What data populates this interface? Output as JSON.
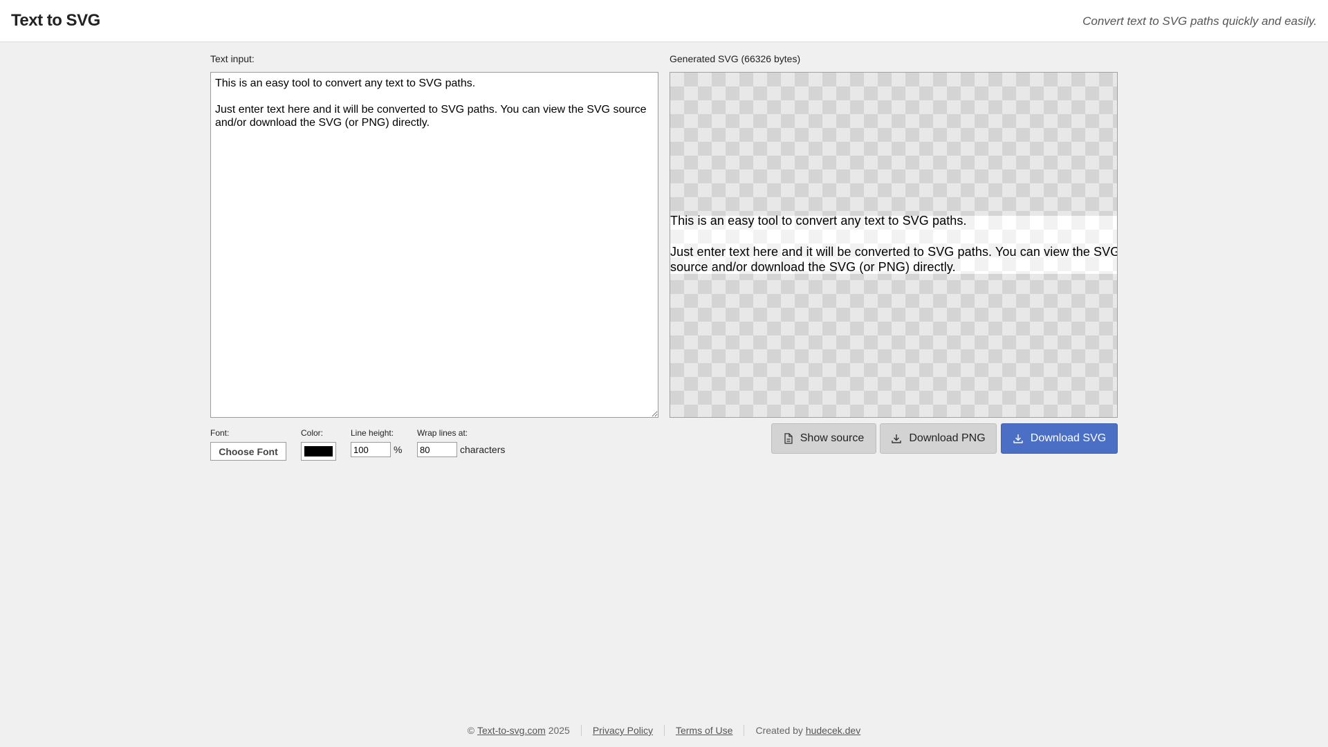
{
  "header": {
    "title": "Text to SVG",
    "tagline": "Convert text to SVG paths quickly and easily."
  },
  "input_panel": {
    "label": "Text input:",
    "text": "This is an easy tool to convert any text to SVG paths.\n\nJust enter text here and it will be converted to SVG paths. You can view the SVG source and/or download the SVG (or PNG) directly."
  },
  "output_panel": {
    "label": "Generated SVG (66326 bytes)",
    "preview_lines": [
      "This is an easy tool to convert any text to SVG paths.",
      "",
      "Just enter text here and it will be converted to SVG paths. You can view the SVG",
      "source and/or download the SVG (or PNG) directly."
    ]
  },
  "controls": {
    "font_label": "Font:",
    "font_button": "Choose Font",
    "color_label": "Color:",
    "color_value": "#000000",
    "line_height_label": "Line height:",
    "line_height_value": "100",
    "line_height_unit": "%",
    "wrap_label": "Wrap lines at:",
    "wrap_value": "80",
    "wrap_unit": "characters"
  },
  "actions": {
    "show_source": "Show source",
    "download_png": "Download PNG",
    "download_svg": "Download SVG",
    "accent_color": "#4a6fc4"
  },
  "footer": {
    "copyright_prefix": "©",
    "site_link": "Text-to-svg.com",
    "year": "2025",
    "privacy": "Privacy Policy",
    "terms": "Terms of Use",
    "created_by_prefix": "Created by",
    "author_link": "hudecek.dev"
  }
}
